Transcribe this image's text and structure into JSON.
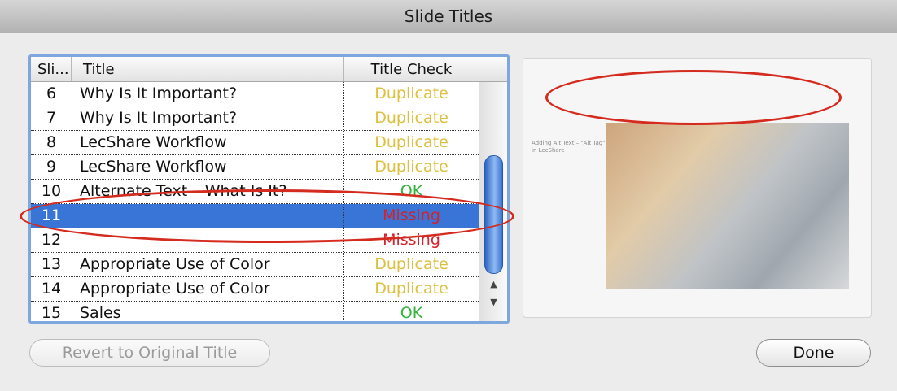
{
  "window": {
    "title": "Slide Titles"
  },
  "table": {
    "columns": [
      "Sli...",
      "Title",
      "Title Check"
    ],
    "rows": [
      {
        "num": "6",
        "title": "Why Is It Important?",
        "check": "Duplicate",
        "status": "duplicate"
      },
      {
        "num": "7",
        "title": "Why Is It Important?",
        "check": "Duplicate",
        "status": "duplicate"
      },
      {
        "num": "8",
        "title": "LecShare Workflow",
        "check": "Duplicate",
        "status": "duplicate"
      },
      {
        "num": "9",
        "title": "LecShare Workflow",
        "check": "Duplicate",
        "status": "duplicate"
      },
      {
        "num": "10",
        "title": "Alternate Text – What Is It?",
        "check": "OK",
        "status": "ok"
      },
      {
        "num": "11",
        "title": "",
        "check": "Missing",
        "status": "missing",
        "selected": true
      },
      {
        "num": "12",
        "title": "",
        "check": "Missing",
        "status": "missing"
      },
      {
        "num": "13",
        "title": "Appropriate Use of Color",
        "check": "Duplicate",
        "status": "duplicate"
      },
      {
        "num": "14",
        "title": "Appropriate Use of Color",
        "check": "Duplicate",
        "status": "duplicate"
      },
      {
        "num": "15",
        "title": "Sales",
        "check": "OK",
        "status": "ok"
      }
    ]
  },
  "preview": {
    "slide_text": "Adding Alt Text – \"Alt Tag\" in LecShare"
  },
  "buttons": {
    "revert": "Revert to Original Title",
    "done": "Done"
  },
  "colors": {
    "selection": "#3875d7",
    "duplicate": "#dcc03e",
    "ok": "#34b33c",
    "missing": "#d4222a",
    "annotation": "#d42b1e"
  }
}
